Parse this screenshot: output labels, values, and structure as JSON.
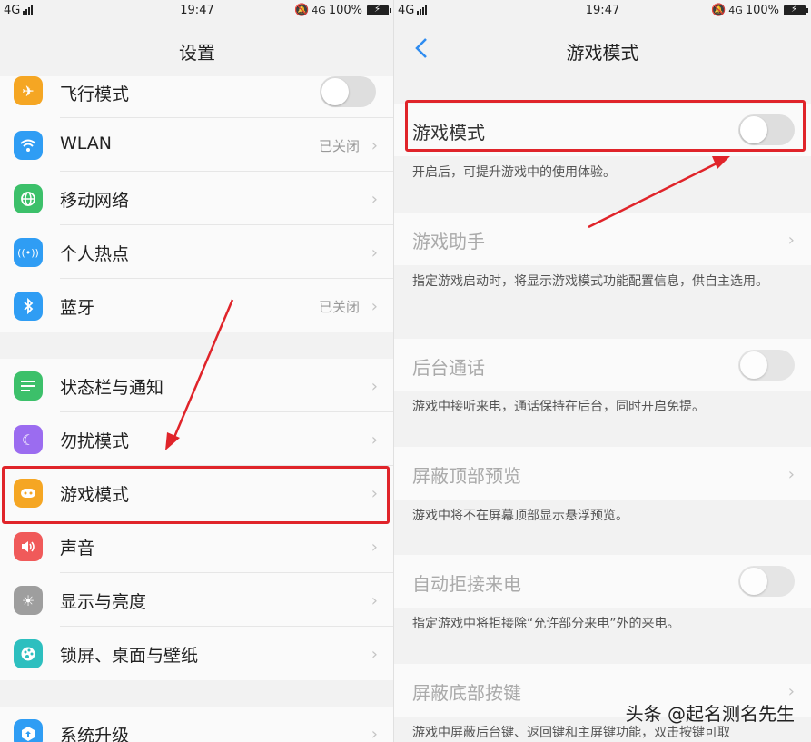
{
  "left": {
    "status": {
      "network": "4G",
      "time": "19:47",
      "battery": "100%"
    },
    "title": "设置",
    "items": [
      {
        "label": "飞行模式",
        "icon": "airplane-icon",
        "color": "#f5a623",
        "toggle": "off"
      },
      {
        "label": "WLAN",
        "icon": "wifi-icon",
        "color": "#2f9df4",
        "value": "已关闭"
      },
      {
        "label": "移动网络",
        "icon": "globe-icon",
        "color": "#3cc06a"
      },
      {
        "label": "个人热点",
        "icon": "hotspot-icon",
        "color": "#2f9df4"
      },
      {
        "label": "蓝牙",
        "icon": "bluetooth-icon",
        "color": "#2f9df4",
        "value": "已关闭"
      },
      {
        "label": "状态栏与通知",
        "icon": "list-icon",
        "color": "#3cc06a"
      },
      {
        "label": "勿扰模式",
        "icon": "moon-icon",
        "color": "#9b6cf0"
      },
      {
        "label": "游戏模式",
        "icon": "gamepad-icon",
        "color": "#f5a623"
      },
      {
        "label": "声音",
        "icon": "speaker-icon",
        "color": "#f05a5a"
      },
      {
        "label": "显示与亮度",
        "icon": "brightness-icon",
        "color": "#9e9e9e"
      },
      {
        "label": "锁屏、桌面与壁纸",
        "icon": "palette-icon",
        "color": "#2dbfbf"
      },
      {
        "label": "系统升级",
        "icon": "upgrade-icon",
        "color": "#2f9df4"
      }
    ]
  },
  "right": {
    "status": {
      "network": "4G",
      "time": "19:47",
      "battery": "100%"
    },
    "title": "游戏模式",
    "game_mode": {
      "label": "游戏模式",
      "toggle": "off",
      "desc": "开启后，可提升游戏中的使用体验。"
    },
    "assistant": {
      "label": "游戏助手",
      "desc": "指定游戏启动时，将显示游戏模式功能配置信息，供自主选用。"
    },
    "background_call": {
      "label": "后台通话",
      "toggle": "off",
      "desc": "游戏中接听来电，通话保持在后台，同时开启免提。"
    },
    "block_top": {
      "label": "屏蔽顶部预览",
      "desc": "游戏中将不在屏幕顶部显示悬浮预览。"
    },
    "auto_reject": {
      "label": "自动拒接来电",
      "toggle": "off",
      "desc": "指定游戏中将拒接除“允许部分来电”外的来电。"
    },
    "block_bottom": {
      "label": "屏蔽底部按键",
      "desc": "游戏中屏蔽后台键、返回键和主屏键功能，双击按键可取"
    }
  },
  "watermark": "头条 @起名测名先生",
  "colors": {
    "highlight": "#e0242a",
    "arrow": "#e0242a"
  }
}
